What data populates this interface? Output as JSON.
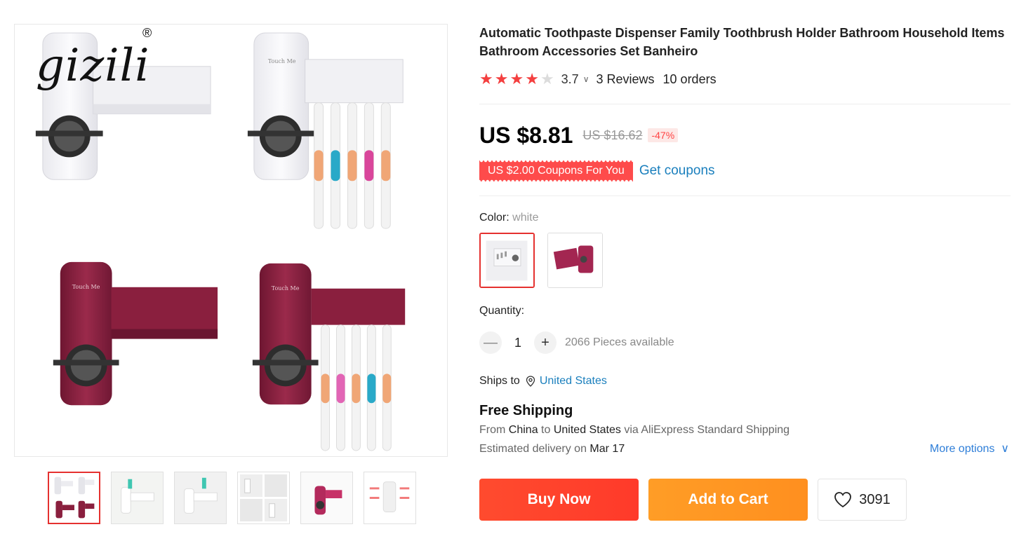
{
  "gallery": {
    "brand": "gizili",
    "brand_mark": "®",
    "product_label": "Touch Me",
    "thumbnails": [
      "thumb-1",
      "thumb-2",
      "thumb-3",
      "thumb-4",
      "thumb-5",
      "thumb-6"
    ],
    "active_thumbnail": 0
  },
  "product": {
    "title": "Automatic Toothpaste Dispenser Family Toothbrush Holder Bathroom Household Items Bathroom Accessories Set Banheiro",
    "rating": 3.7,
    "rating_label": "3.7",
    "reviews": "3 Reviews",
    "orders": "10 orders"
  },
  "price": {
    "current": "US $8.81",
    "original": "US $16.62",
    "discount": "-47%"
  },
  "coupon": {
    "tag": "US $2.00 Coupons For You",
    "link": "Get coupons"
  },
  "color": {
    "label": "Color:",
    "selected": "white",
    "options": [
      "white",
      "wine red"
    ]
  },
  "quantity": {
    "label": "Quantity:",
    "value": "1",
    "minus": "—",
    "plus": "+",
    "available": "2066 Pieces available"
  },
  "shipping": {
    "ships_to_label": "Ships to",
    "country": "United States",
    "title": "Free Shipping",
    "from_prefix": "From",
    "from": "China",
    "to_prefix": "to",
    "to": "United States",
    "via": "via AliExpress Standard Shipping",
    "delivery_prefix": "Estimated delivery on",
    "delivery_date": "Mar 17",
    "more_options": "More options"
  },
  "actions": {
    "buy_now": "Buy Now",
    "add_to_cart": "Add to Cart",
    "wishlist_count": "3091"
  },
  "colors": {
    "accent": "#e5312f",
    "link": "#1a7fbd",
    "buy": "#ff4b2e",
    "cart": "#ff9d26",
    "product_white": "#f4f4f6",
    "product_red": "#8a1f3e"
  },
  "icons": {
    "star": "star-icon",
    "pin": "location-pin-icon",
    "heart": "heart-icon",
    "chevron": "chevron-down-icon"
  }
}
